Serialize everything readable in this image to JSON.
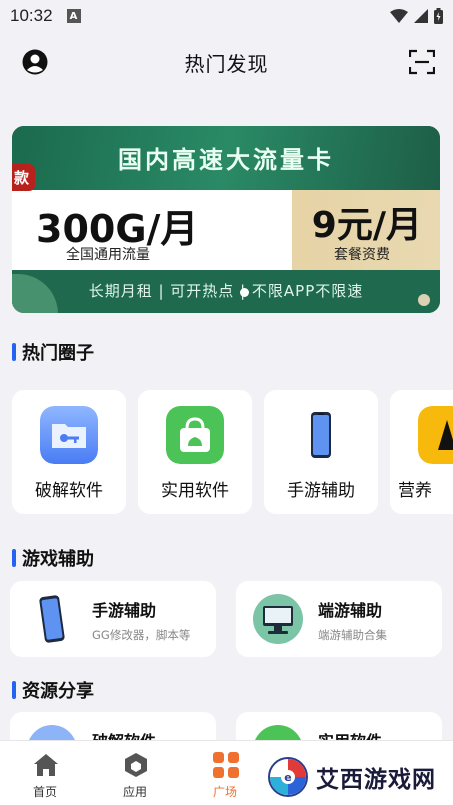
{
  "status_bar": {
    "time": "10:32",
    "notification_icon": "A"
  },
  "header": {
    "title": "热门发现"
  },
  "banner": {
    "headline": "国内高速大流量卡",
    "tag": "款",
    "data_amount": "300G/月",
    "data_desc": "全国通用流量",
    "price": "9元/月",
    "price_desc": "套餐资费",
    "slogan": "长期月租 | 可开热点 | 不限APP不限速"
  },
  "sections": {
    "hot_circles": "热门圈子",
    "game_assist": "游戏辅助",
    "resource_share": "资源分享"
  },
  "hot_circles": [
    {
      "label": "破解软件",
      "icon": "folder-key-icon"
    },
    {
      "label": "实用软件",
      "icon": "shopping-bag-icon"
    },
    {
      "label": "手游辅助",
      "icon": "phone-icon"
    },
    {
      "label": "营养",
      "icon": "yellow-app-icon"
    }
  ],
  "game_assist": [
    {
      "title": "手游辅助",
      "subtitle": "GG修改器，脚本等",
      "icon": "phone-icon"
    },
    {
      "title": "端游辅助",
      "subtitle": "端游辅助合集",
      "icon": "monitor-icon"
    }
  ],
  "resource_share": [
    {
      "title": "破解软件",
      "icon": "folder-key-icon"
    },
    {
      "title": "实用软件",
      "icon": "shopping-bag-icon"
    }
  ],
  "tabs": [
    {
      "label": "首页",
      "icon": "home-icon"
    },
    {
      "label": "应用",
      "icon": "cube-icon"
    },
    {
      "label": "广场",
      "icon": "grid-icon",
      "active": true
    }
  ],
  "watermark": {
    "text": "艾西游戏网"
  },
  "colors": {
    "accent": "#2463f2",
    "active_tab": "#f07030",
    "banner_green": "#1e6a4f"
  }
}
